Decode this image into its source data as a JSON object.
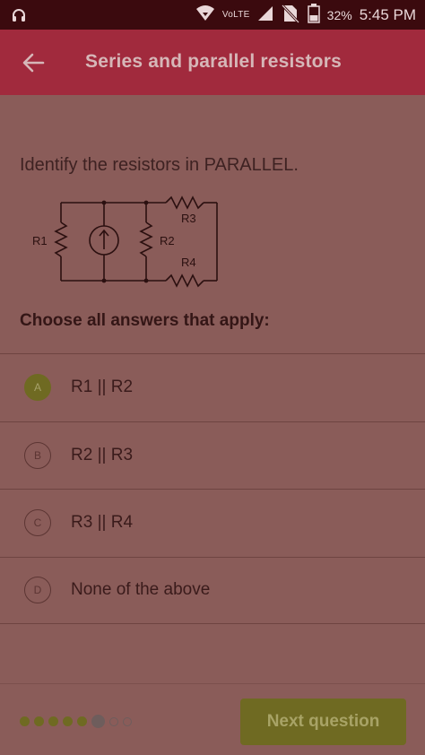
{
  "status_bar": {
    "network_label": "VoLTE",
    "battery_percent": "32%",
    "time": "5:45 PM"
  },
  "app_bar": {
    "title": "Series and parallel resistors"
  },
  "question": {
    "text": "Identify the resistors in PARALLEL.",
    "diagram_labels": {
      "r1": "R1",
      "r2": "R2",
      "r3": "R3",
      "r4": "R4"
    },
    "instruction": "Choose all answers that apply:"
  },
  "options": [
    {
      "letter": "A",
      "label": "R1 || R2",
      "selected": true
    },
    {
      "letter": "B",
      "label": "R2 || R3",
      "selected": false
    },
    {
      "letter": "C",
      "label": "R3 || R4",
      "selected": false
    },
    {
      "letter": "D",
      "label": "None of the above",
      "selected": false
    }
  ],
  "footer": {
    "progress": {
      "completed": 5,
      "current": 6,
      "total": 8
    },
    "next_label": "Next question"
  },
  "colors": {
    "app_bar": "#a12a3d",
    "background": "#8a5c59",
    "accent": "#6f6a22"
  }
}
